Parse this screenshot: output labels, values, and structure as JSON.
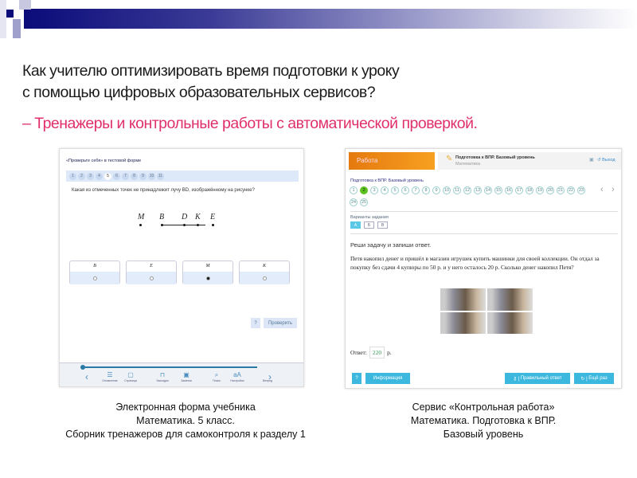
{
  "heading": {
    "line1": "Как учителю оптимизировать время подготовки к уроку",
    "line2": "с помощью цифровых образовательных сервисов?",
    "subtitle": "– Тренажеры и контрольные работы с автоматической проверкой."
  },
  "left": {
    "header": "«Проверьте себя» в тестовой форме",
    "questions": [
      "1",
      "2",
      "3",
      "4",
      "5",
      "6",
      "7",
      "8",
      "9",
      "10",
      "11"
    ],
    "active_question": "5",
    "question": "Какая из отмеченных точек не принадлежит лучу BD, изображённому на рисунке?",
    "points": [
      "M",
      "B",
      "D",
      "K",
      "E"
    ],
    "answers": [
      {
        "label": "B",
        "selected": false
      },
      {
        "label": "E",
        "selected": false
      },
      {
        "label": "M",
        "selected": true
      },
      {
        "label": "K",
        "selected": false
      }
    ],
    "help_label": "?",
    "check_label": "Проверить",
    "toolbar": [
      "Оглавление",
      "Страница",
      "Закладки",
      "Заметки",
      "Поиск",
      "Настройки",
      "Вперед"
    ],
    "caption": [
      "Электронная форма учебника",
      "Математика. 5 класс.",
      "Сборник тренажеров для самоконтроля к разделу 1"
    ]
  },
  "right": {
    "tab": "Работа",
    "work_title": "Подготовка к ВПР. Базовый уровень",
    "subject": "Математика",
    "exit_label": "Выход",
    "section_title": "Подготовка к ВПР. Базовый уровень",
    "questions": [
      "1",
      "2",
      "3",
      "4",
      "5",
      "6",
      "7",
      "8",
      "9",
      "10",
      "11",
      "12",
      "13",
      "14",
      "15",
      "16",
      "17",
      "18",
      "19",
      "20",
      "21",
      "22",
      "23",
      "24",
      "25"
    ],
    "active_question": "2",
    "variants_label": "Варианты задания",
    "variants": [
      "А",
      "Б",
      "В"
    ],
    "active_variant": "А",
    "instruction": "Реши задачу и запиши ответ.",
    "problem": "Петя накопил денег и пришёл в магазин игрушек купить машинки для своей коллекции. Он отдал за покупку без сдачи 4 купюры по 50 р. и у него осталось 20 р. Сколько денег накопил Петя?",
    "answer_label": "Ответ:",
    "answer_value": "220",
    "answer_unit": "р.",
    "help_label": "?",
    "info_label": "Информация",
    "correct_label": "Правильный ответ",
    "retry_label": "Ещё раз",
    "caption": [
      "Сервис «Контрольная работа»",
      "Математика. Подготовка к ВПР.",
      "Базовый уровень"
    ]
  },
  "colors": {
    "accent_pink": "#e0306a",
    "orange": "#f08a10",
    "green": "#5ec21e",
    "cyan": "#3cb8de"
  }
}
